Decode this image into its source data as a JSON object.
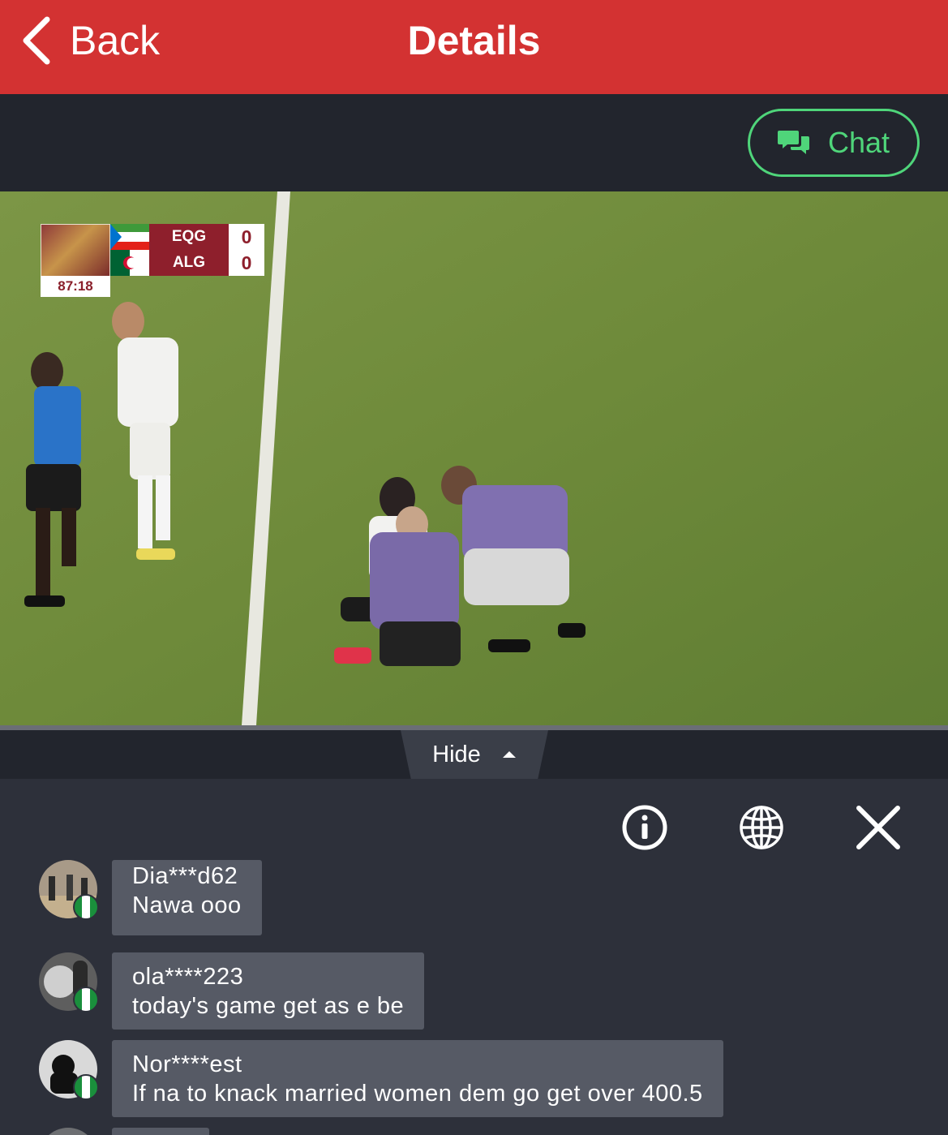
{
  "header": {
    "back_label": "Back",
    "title": "Details"
  },
  "chat_button": {
    "label": "Chat",
    "color": "#4fd57a"
  },
  "video": {
    "scoreboard": {
      "clock": "87:18",
      "teams": [
        {
          "code": "EQG",
          "score": "0"
        },
        {
          "code": "ALG",
          "score": "0"
        }
      ]
    }
  },
  "hide_tab": {
    "label": "Hide"
  },
  "chat_toolbar": {
    "icons": [
      "info-icon",
      "globe-icon",
      "close-icon"
    ]
  },
  "messages": [
    {
      "user": "Dia***d62",
      "text": "Nawa ooo"
    },
    {
      "user": "ola****223",
      "text": "today's game get as e be"
    },
    {
      "user": "Nor****est",
      "text": "If na to knack married women dem go get over 400.5"
    }
  ],
  "colors": {
    "header": "#d33232",
    "background": "#22252d",
    "panel": "#2d303a",
    "bubble": "#565a65"
  }
}
